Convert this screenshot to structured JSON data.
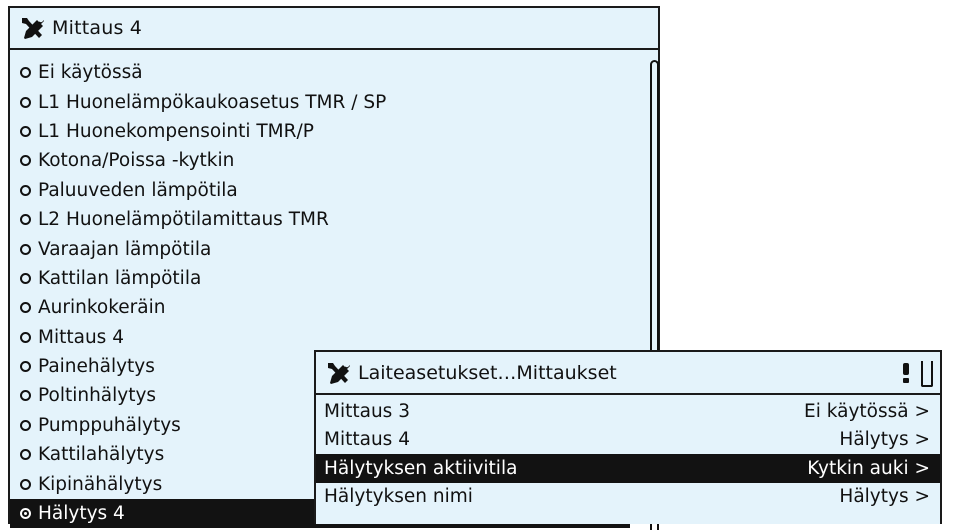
{
  "back_panel": {
    "icon": "tools-icon",
    "title": "Mittaus 4",
    "items": [
      {
        "label": "Ei käytössä"
      },
      {
        "label": "L1 Huonelämpökaukoasetus TMR / SP"
      },
      {
        "label": "L1 Huonekompensointi TMR/P"
      },
      {
        "label": "Kotona/Poissa -kytkin"
      },
      {
        "label": "Paluuveden lämpötila"
      },
      {
        "label": "L2 Huonelämpötilamittaus TMR"
      },
      {
        "label": "Varaajan lämpötila"
      },
      {
        "label": "Kattilan lämpötila"
      },
      {
        "label": "Aurinkokeräin"
      },
      {
        "label": "Mittaus 4"
      },
      {
        "label": "Painehälytys"
      },
      {
        "label": "Poltinhälytys"
      },
      {
        "label": "Pumppuhälytys"
      },
      {
        "label": "Kattilahälytys"
      },
      {
        "label": "Kipinähälytys"
      },
      {
        "label": "Hälytys 4"
      }
    ],
    "selected_index": 15
  },
  "front_dialog": {
    "icon": "tools-icon",
    "title": "Laiteasetukset…Mittaukset",
    "status_icons": [
      "alarm-icon",
      "battery-icon"
    ],
    "rows": [
      {
        "label": "Mittaus 3",
        "value": "Ei käytössä"
      },
      {
        "label": "Mittaus 4",
        "value": "Hälytys"
      },
      {
        "label": "Hälytyksen aktiivitila",
        "value": "Kytkin auki"
      },
      {
        "label": "Hälytyksen nimi",
        "value": "Hälytys"
      }
    ],
    "selected_index": 2
  },
  "colors": {
    "panel_bg": "#e4f3fb",
    "border": "#1a1a1a",
    "selection_bg": "#121212",
    "selection_text": "#ffffff"
  }
}
